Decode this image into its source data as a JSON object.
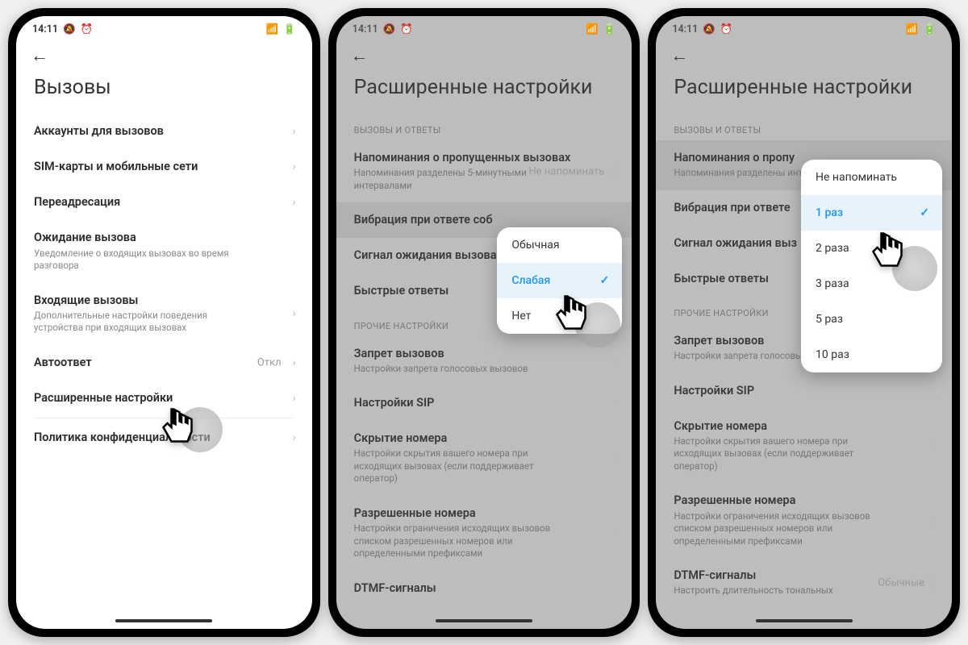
{
  "status": {
    "time": "14:11",
    "mute_icon": "🔕",
    "alarm_icon": "⏰",
    "signal_icon": "📶",
    "battery_icon": "🔋"
  },
  "screen1": {
    "title": "Вызовы",
    "items": [
      {
        "title": "Аккаунты для вызовов"
      },
      {
        "title": "SIM-карты и мобильные сети"
      },
      {
        "title": "Переадресация"
      },
      {
        "title": "Ожидание вызова",
        "sub": "Уведомление о входящих вызовах во время разговора"
      },
      {
        "title": "Входящие вызовы",
        "sub": "Дополнительные настройки поведения устройства при входящих вызовах"
      },
      {
        "title": "Автоответ",
        "value": "Откл"
      },
      {
        "title": "Расширенные настройки"
      },
      {
        "title": "Политика конфиденциальности"
      }
    ]
  },
  "screen2": {
    "title": "Расширенные настройки",
    "section1": "ВЫЗОВЫ И ОТВЕТЫ",
    "items_top": [
      {
        "title": "Напоминания о пропущенных вызовах",
        "sub": "Напоминания разделены 5-минутными интервалами",
        "value": "Не напоминать"
      },
      {
        "title": "Вибрация при ответе соб"
      },
      {
        "title": "Сигнал ожидания вызова"
      },
      {
        "title": "Быстрые ответы"
      }
    ],
    "section2": "ПРОЧИЕ НАСТРОЙКИ",
    "items_bottom": [
      {
        "title": "Запрет вызовов",
        "sub": "Настройки запрета голосовых вызовов"
      },
      {
        "title": "Настройки SIP"
      },
      {
        "title": "Скрытие номера",
        "sub": "Настройки скрытия вашего номера при исходящих вызовах (если поддерживает оператор)"
      },
      {
        "title": "Разрешенные номера",
        "sub": "Настройки ограничения исходящих вызовов списком разрешенных номеров или определенными префиксами"
      },
      {
        "title": "DTMF-сигналы"
      }
    ],
    "popup": {
      "options": [
        "Обычная",
        "Слабая",
        "Нет"
      ],
      "selected": "Слабая"
    }
  },
  "screen3": {
    "title": "Расширенные настройки",
    "section1": "ВЫЗОВЫ И ОТВЕТЫ",
    "items_top": [
      {
        "title": "Напоминания о пропу",
        "sub": "Напоминания разделены интервалами"
      },
      {
        "title": "Вибрация при ответе"
      },
      {
        "title": "Сигнал ожидания выз"
      },
      {
        "title": "Быстрые ответы"
      }
    ],
    "section2": "ПРОЧИЕ НАСТРОЙКИ",
    "items_bottom": [
      {
        "title": "Запрет вызовов",
        "sub": "Настройки запрета голосовых вызовов"
      },
      {
        "title": "Настройки SIP"
      },
      {
        "title": "Скрытие номера",
        "sub": "Настройки скрытия вашего номера при исходящих вызовах (если поддерживает оператор)"
      },
      {
        "title": "Разрешенные номера",
        "sub": "Настройки ограничения исходящих вызовов списком разрешенных номеров или определенными префиксами"
      },
      {
        "title": "DTMF-сигналы",
        "sub": "Настроить длительность тональных",
        "value": "Обычные"
      }
    ],
    "popup": {
      "options": [
        "Не напоминать",
        "1 раз",
        "2 раза",
        "3 раза",
        "5 раз",
        "10 раз"
      ],
      "selected": "1 раз"
    }
  }
}
